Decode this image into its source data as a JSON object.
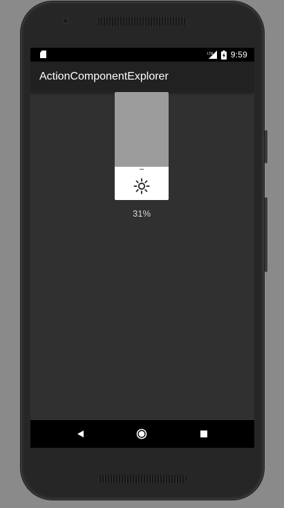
{
  "status_bar": {
    "time": "9:59",
    "sd_icon": "sd-card-icon",
    "signal_icon": "cell-signal-icon",
    "battery_icon": "battery-charging-icon"
  },
  "app_bar": {
    "title": "ActionComponentExplorer"
  },
  "brightness_slider": {
    "value_fraction": 0.31,
    "value_label": "31%",
    "icon": "brightness-icon",
    "track_color": "#9c9c9c",
    "fill_color": "#ffffff"
  },
  "nav_bar": {
    "back_icon": "back-triangle-icon",
    "home_icon": "home-circle-icon",
    "recents_icon": "recents-square-icon"
  },
  "colors": {
    "background": "#303030",
    "app_bar": "#212121",
    "status_bar": "#000000",
    "nav_bar": "#000000"
  }
}
